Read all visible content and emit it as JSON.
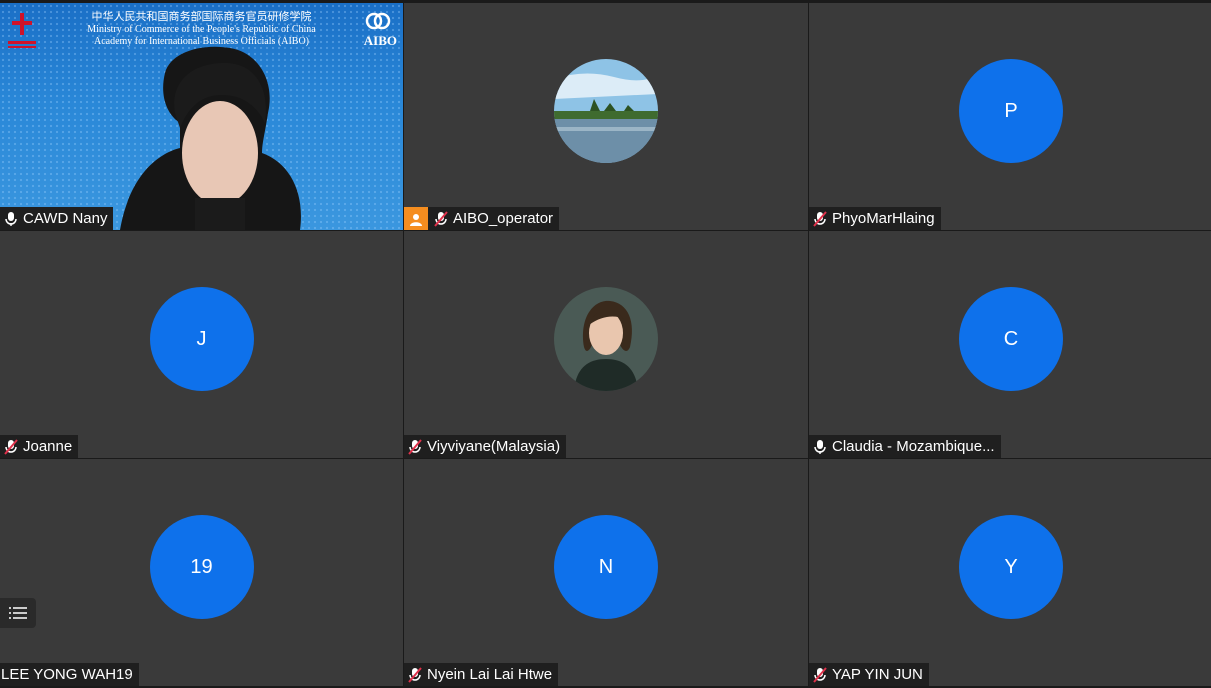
{
  "banner": {
    "cn": "中华人民共和国商务部国际商务官员研修学院",
    "en1": "Ministry of Commerce of the People's Republic of China",
    "en2": "Academy for International Business Officials (AIBO)",
    "logo": "AIBO"
  },
  "colors": {
    "avatar_blue": "#0e71eb",
    "tile_bg": "#3a3a3a",
    "muted_mic": "#e0314b",
    "video_badge": "#f58d1f"
  },
  "participants": [
    {
      "name": "CAWD Nany",
      "type": "video",
      "mic": "unmuted"
    },
    {
      "name": "AIBO_operator",
      "type": "photo-landscape",
      "mic": "muted",
      "camera_off_badge": true
    },
    {
      "name": "PhyoMarHlaing",
      "type": "initial",
      "initial": "P",
      "mic": "muted"
    },
    {
      "name": "Joanne",
      "type": "initial",
      "initial": "J",
      "mic": "muted"
    },
    {
      "name": "Viyviyane(Malaysia)",
      "type": "photo-portrait",
      "mic": "muted"
    },
    {
      "name": "Claudia - Mozambique...",
      "type": "initial",
      "initial": "C",
      "mic": "unmuted"
    },
    {
      "name": "LEE YONG WAH19",
      "type": "initial",
      "initial": "19",
      "mic": "none"
    },
    {
      "name": "Nyein Lai Lai Htwe",
      "type": "initial",
      "initial": "N",
      "mic": "muted"
    },
    {
      "name": "YAP YIN JUN",
      "type": "initial",
      "initial": "Y",
      "mic": "muted"
    }
  ]
}
